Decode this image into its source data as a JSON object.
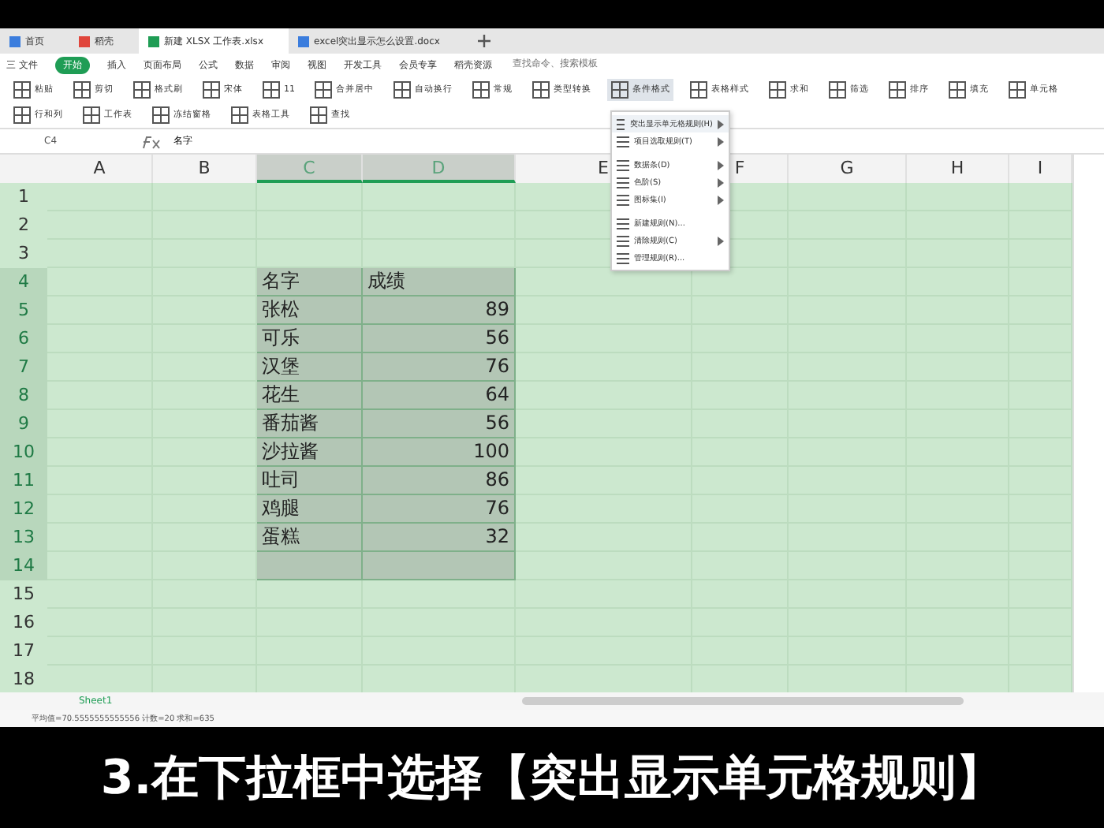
{
  "doc_tabs": [
    {
      "label": "首页",
      "selected": false,
      "kind": "home"
    },
    {
      "label": "稻壳",
      "selected": false,
      "kind": "app"
    },
    {
      "label": "新建 XLSX 工作表.xlsx",
      "selected": true,
      "kind": "sheet"
    },
    {
      "label": "excel突出显示怎么设置.docx",
      "selected": false,
      "kind": "doc"
    }
  ],
  "menu": {
    "file": "三 文件",
    "tabs": [
      {
        "label": "开始",
        "selected": true
      },
      {
        "label": "插入",
        "selected": false
      },
      {
        "label": "页面布局",
        "selected": false
      },
      {
        "label": "公式",
        "selected": false
      },
      {
        "label": "数据",
        "selected": false
      },
      {
        "label": "审阅",
        "selected": false
      },
      {
        "label": "视图",
        "selected": false
      },
      {
        "label": "开发工具",
        "selected": false
      },
      {
        "label": "会员专享",
        "selected": false
      },
      {
        "label": "稻壳资源",
        "selected": false
      }
    ],
    "search_placeholder": "查找命令、搜索模板"
  },
  "ribbon": [
    {
      "label": "粘贴",
      "selected": false
    },
    {
      "label": "剪切",
      "selected": false
    },
    {
      "label": "格式刷",
      "selected": false
    },
    {
      "label": "宋体",
      "selected": false
    },
    {
      "label": "11",
      "selected": false
    },
    {
      "label": "合并居中",
      "selected": false
    },
    {
      "label": "自动换行",
      "selected": false
    },
    {
      "label": "常规",
      "selected": false
    },
    {
      "label": "类型转换",
      "selected": false
    },
    {
      "label": "条件格式",
      "selected": true
    },
    {
      "label": "表格样式",
      "selected": false
    },
    {
      "label": "求和",
      "selected": false
    },
    {
      "label": "筛选",
      "selected": false
    },
    {
      "label": "排序",
      "selected": false
    },
    {
      "label": "填充",
      "selected": false
    },
    {
      "label": "单元格",
      "selected": false
    },
    {
      "label": "行和列",
      "selected": false
    },
    {
      "label": "工作表",
      "selected": false
    },
    {
      "label": "冻结窗格",
      "selected": false
    },
    {
      "label": "表格工具",
      "selected": false
    },
    {
      "label": "查找",
      "selected": false
    }
  ],
  "formula_bar": {
    "name_box": "C4",
    "value": "名字"
  },
  "columns": [
    {
      "label": "A",
      "selected": false
    },
    {
      "label": "B",
      "selected": false
    },
    {
      "label": "C",
      "selected": true
    },
    {
      "label": "D",
      "selected": true
    },
    {
      "label": "E",
      "selected": false
    },
    {
      "label": "F",
      "selected": false
    },
    {
      "label": "G",
      "selected": false
    },
    {
      "label": "H",
      "selected": false
    },
    {
      "label": "I",
      "selected": false
    }
  ],
  "rows": [
    {
      "label": "1",
      "selected": false,
      "cells": []
    },
    {
      "label": "2",
      "selected": false,
      "cells": []
    },
    {
      "label": "3",
      "selected": false,
      "cells": []
    },
    {
      "label": "4",
      "selected": true,
      "kind": "header",
      "cells": [
        "名字",
        "成绩"
      ]
    },
    {
      "label": "5",
      "selected": true,
      "kind": "data",
      "cells": [
        "张松",
        "89"
      ]
    },
    {
      "label": "6",
      "selected": true,
      "kind": "data",
      "cells": [
        "可乐",
        "56"
      ]
    },
    {
      "label": "7",
      "selected": true,
      "kind": "data",
      "cells": [
        "汉堡",
        "76"
      ]
    },
    {
      "label": "8",
      "selected": true,
      "kind": "data",
      "cells": [
        "花生",
        "64"
      ]
    },
    {
      "label": "9",
      "selected": true,
      "kind": "data",
      "cells": [
        "番茄酱",
        "56"
      ]
    },
    {
      "label": "10",
      "selected": true,
      "kind": "data",
      "cells": [
        "沙拉酱",
        "100"
      ]
    },
    {
      "label": "11",
      "selected": true,
      "kind": "data",
      "cells": [
        "吐司",
        "86"
      ]
    },
    {
      "label": "12",
      "selected": true,
      "kind": "data",
      "cells": [
        "鸡腿",
        "76"
      ]
    },
    {
      "label": "13",
      "selected": true,
      "kind": "data",
      "cells": [
        "蛋糕",
        "32"
      ]
    },
    {
      "label": "14",
      "selected": true,
      "kind": "data",
      "cells": [
        "",
        ""
      ]
    },
    {
      "label": "15",
      "selected": false,
      "cells": []
    },
    {
      "label": "16",
      "selected": false,
      "cells": []
    },
    {
      "label": "17",
      "selected": false,
      "cells": []
    },
    {
      "label": "18",
      "selected": false,
      "cells": []
    }
  ],
  "dropdown": [
    {
      "label": "突出显示单元格规则(H)",
      "submenu": true,
      "selected": true
    },
    {
      "label": "项目选取规则(T)",
      "submenu": true,
      "selected": false
    },
    {
      "label": "数据条(D)",
      "submenu": true,
      "selected": false
    },
    {
      "label": "色阶(S)",
      "submenu": true,
      "selected": false
    },
    {
      "label": "图标集(I)",
      "submenu": true,
      "selected": false
    },
    {
      "label": "新建规则(N)...",
      "submenu": false,
      "selected": false
    },
    {
      "label": "清除规则(C)",
      "submenu": true,
      "selected": false
    },
    {
      "label": "管理规则(R)...",
      "submenu": false,
      "selected": false
    }
  ],
  "sheet_tabs": [
    {
      "label": "Sheet1",
      "selected": true
    }
  ],
  "status_bar": "平均值=70.5555555555556 计数=20 求和=635",
  "caption": "3.在下拉框中选择【突出显示单元格规则】"
}
